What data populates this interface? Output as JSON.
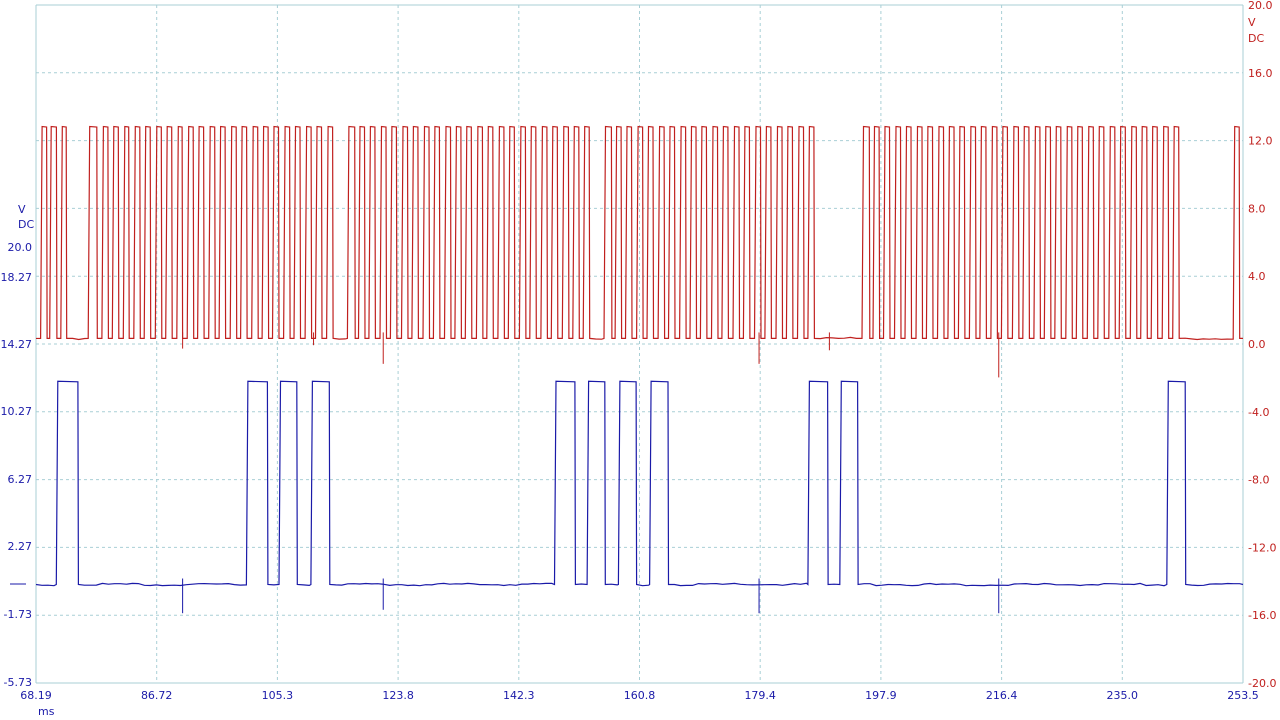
{
  "chart_data": {
    "type": "line",
    "x_unit": "ms",
    "x_ticks": [
      "68.19",
      "86.72",
      "105.3",
      "123.8",
      "142.3",
      "160.8",
      "179.4",
      "197.9",
      "216.4",
      "235.0",
      "253.5"
    ],
    "xlim": [
      68.19,
      253.5
    ],
    "left_axis": {
      "unit": "V",
      "mode": "DC",
      "ticks": [
        "20.0",
        "18.27",
        "14.27",
        "10.27",
        "6.27",
        "2.27",
        "-1.73",
        "-5.73"
      ],
      "color": "#1a1aa8"
    },
    "right_axis": {
      "unit": "V",
      "mode": "DC",
      "ticks": [
        "20.0",
        "16.0",
        "12.0",
        "8.0",
        "4.0",
        "0.0",
        "-4.0",
        "-8.0",
        "-12.0",
        "-16.0",
        "-20.0"
      ],
      "ylim": [
        -20,
        20
      ],
      "color": "#c0201e"
    },
    "grid": true,
    "series": [
      {
        "axis": "right",
        "color": "#c0201e",
        "low": 0.3,
        "high": 12.8,
        "pulses_ms": [
          [
            68.9,
            69.9
          ],
          [
            70.3,
            71.4
          ],
          [
            72.0,
            72.9
          ],
          [
            76.2,
            77.6
          ],
          [
            78.3,
            79.3
          ],
          [
            79.9,
            80.9
          ],
          [
            81.6,
            82.5
          ],
          [
            83.2,
            84.2
          ],
          [
            84.8,
            85.8
          ],
          [
            86.5,
            87.5
          ],
          [
            88.1,
            89.1
          ],
          [
            89.8,
            90.7
          ],
          [
            91.4,
            92.4
          ],
          [
            93.0,
            94.0
          ],
          [
            94.7,
            95.7
          ],
          [
            96.3,
            97.3
          ],
          [
            98.0,
            99.0
          ],
          [
            99.6,
            100.6
          ],
          [
            101.3,
            102.3
          ],
          [
            102.9,
            103.9
          ],
          [
            104.5,
            105.5
          ],
          [
            106.2,
            107.2
          ],
          [
            107.8,
            108.8
          ],
          [
            109.5,
            110.5
          ],
          [
            111.1,
            112.1
          ],
          [
            112.8,
            113.8
          ],
          [
            116.0,
            117.2
          ],
          [
            117.7,
            118.7
          ],
          [
            119.3,
            120.3
          ],
          [
            121.0,
            122.0
          ],
          [
            122.6,
            123.6
          ],
          [
            124.3,
            125.3
          ],
          [
            125.9,
            126.9
          ],
          [
            127.6,
            128.6
          ],
          [
            129.2,
            130.2
          ],
          [
            130.9,
            131.9
          ],
          [
            132.5,
            133.5
          ],
          [
            134.1,
            135.1
          ],
          [
            135.8,
            136.8
          ],
          [
            137.4,
            138.4
          ],
          [
            139.1,
            140.1
          ],
          [
            140.7,
            141.7
          ],
          [
            142.4,
            143.4
          ],
          [
            144.0,
            145.0
          ],
          [
            145.7,
            146.7
          ],
          [
            147.3,
            148.3
          ],
          [
            149.0,
            150.0
          ],
          [
            150.6,
            151.6
          ],
          [
            152.2,
            153.2
          ],
          [
            155.4,
            156.6
          ],
          [
            157.1,
            158.1
          ],
          [
            158.7,
            159.7
          ],
          [
            160.4,
            161.4
          ],
          [
            162.0,
            163.0
          ],
          [
            163.7,
            164.7
          ],
          [
            165.3,
            166.3
          ],
          [
            167.0,
            168.0
          ],
          [
            168.6,
            169.6
          ],
          [
            170.2,
            171.2
          ],
          [
            171.9,
            172.9
          ],
          [
            173.5,
            174.5
          ],
          [
            175.2,
            176.2
          ],
          [
            176.8,
            177.8
          ],
          [
            178.5,
            179.5
          ],
          [
            180.1,
            181.1
          ],
          [
            181.8,
            182.8
          ],
          [
            183.4,
            184.4
          ],
          [
            185.1,
            186.1
          ],
          [
            186.7,
            187.7
          ],
          [
            195.0,
            196.2
          ],
          [
            196.7,
            197.7
          ],
          [
            198.3,
            199.3
          ],
          [
            200.0,
            201.0
          ],
          [
            201.6,
            202.6
          ],
          [
            203.3,
            204.3
          ],
          [
            204.9,
            205.9
          ],
          [
            206.6,
            207.6
          ],
          [
            208.2,
            209.2
          ],
          [
            209.8,
            210.8
          ],
          [
            211.5,
            212.5
          ],
          [
            213.1,
            214.1
          ],
          [
            214.8,
            215.8
          ],
          [
            216.4,
            217.4
          ],
          [
            218.1,
            219.1
          ],
          [
            219.7,
            220.7
          ],
          [
            221.4,
            222.4
          ],
          [
            223.0,
            224.0
          ],
          [
            224.6,
            225.6
          ],
          [
            226.3,
            227.3
          ],
          [
            227.9,
            228.9
          ],
          [
            229.6,
            230.6
          ],
          [
            231.2,
            232.2
          ],
          [
            232.9,
            233.9
          ],
          [
            234.5,
            235.5
          ],
          [
            236.2,
            237.2
          ],
          [
            237.8,
            238.8
          ],
          [
            239.4,
            240.4
          ],
          [
            241.1,
            242.1
          ],
          [
            242.7,
            243.7
          ],
          [
            252.0,
            253.0
          ]
        ],
        "spikes_ms": [
          [
            90.7,
            -0.3
          ],
          [
            110.8,
            -0.1
          ],
          [
            121.5,
            -1.2
          ],
          [
            179.2,
            -1.2
          ],
          [
            190.0,
            -0.4
          ],
          [
            216.0,
            -2.0
          ]
        ]
      },
      {
        "axis": "left",
        "color": "#1a1aa8",
        "low": -0.03,
        "high": 11.8,
        "pulses_ms": [
          [
            71.3,
            74.7
          ],
          [
            100.5,
            103.8
          ],
          [
            105.5,
            108.3
          ],
          [
            110.4,
            113.3
          ],
          [
            147.8,
            151.0
          ],
          [
            152.8,
            155.6
          ],
          [
            157.6,
            160.4
          ],
          [
            162.4,
            165.3
          ],
          [
            186.7,
            189.8
          ],
          [
            191.6,
            194.4
          ],
          [
            241.8,
            244.7
          ]
        ],
        "spikes_ms": [
          [
            90.7,
            -1.7
          ],
          [
            121.5,
            -1.5
          ],
          [
            179.2,
            -1.7
          ],
          [
            216.0,
            -1.7
          ]
        ]
      }
    ]
  }
}
